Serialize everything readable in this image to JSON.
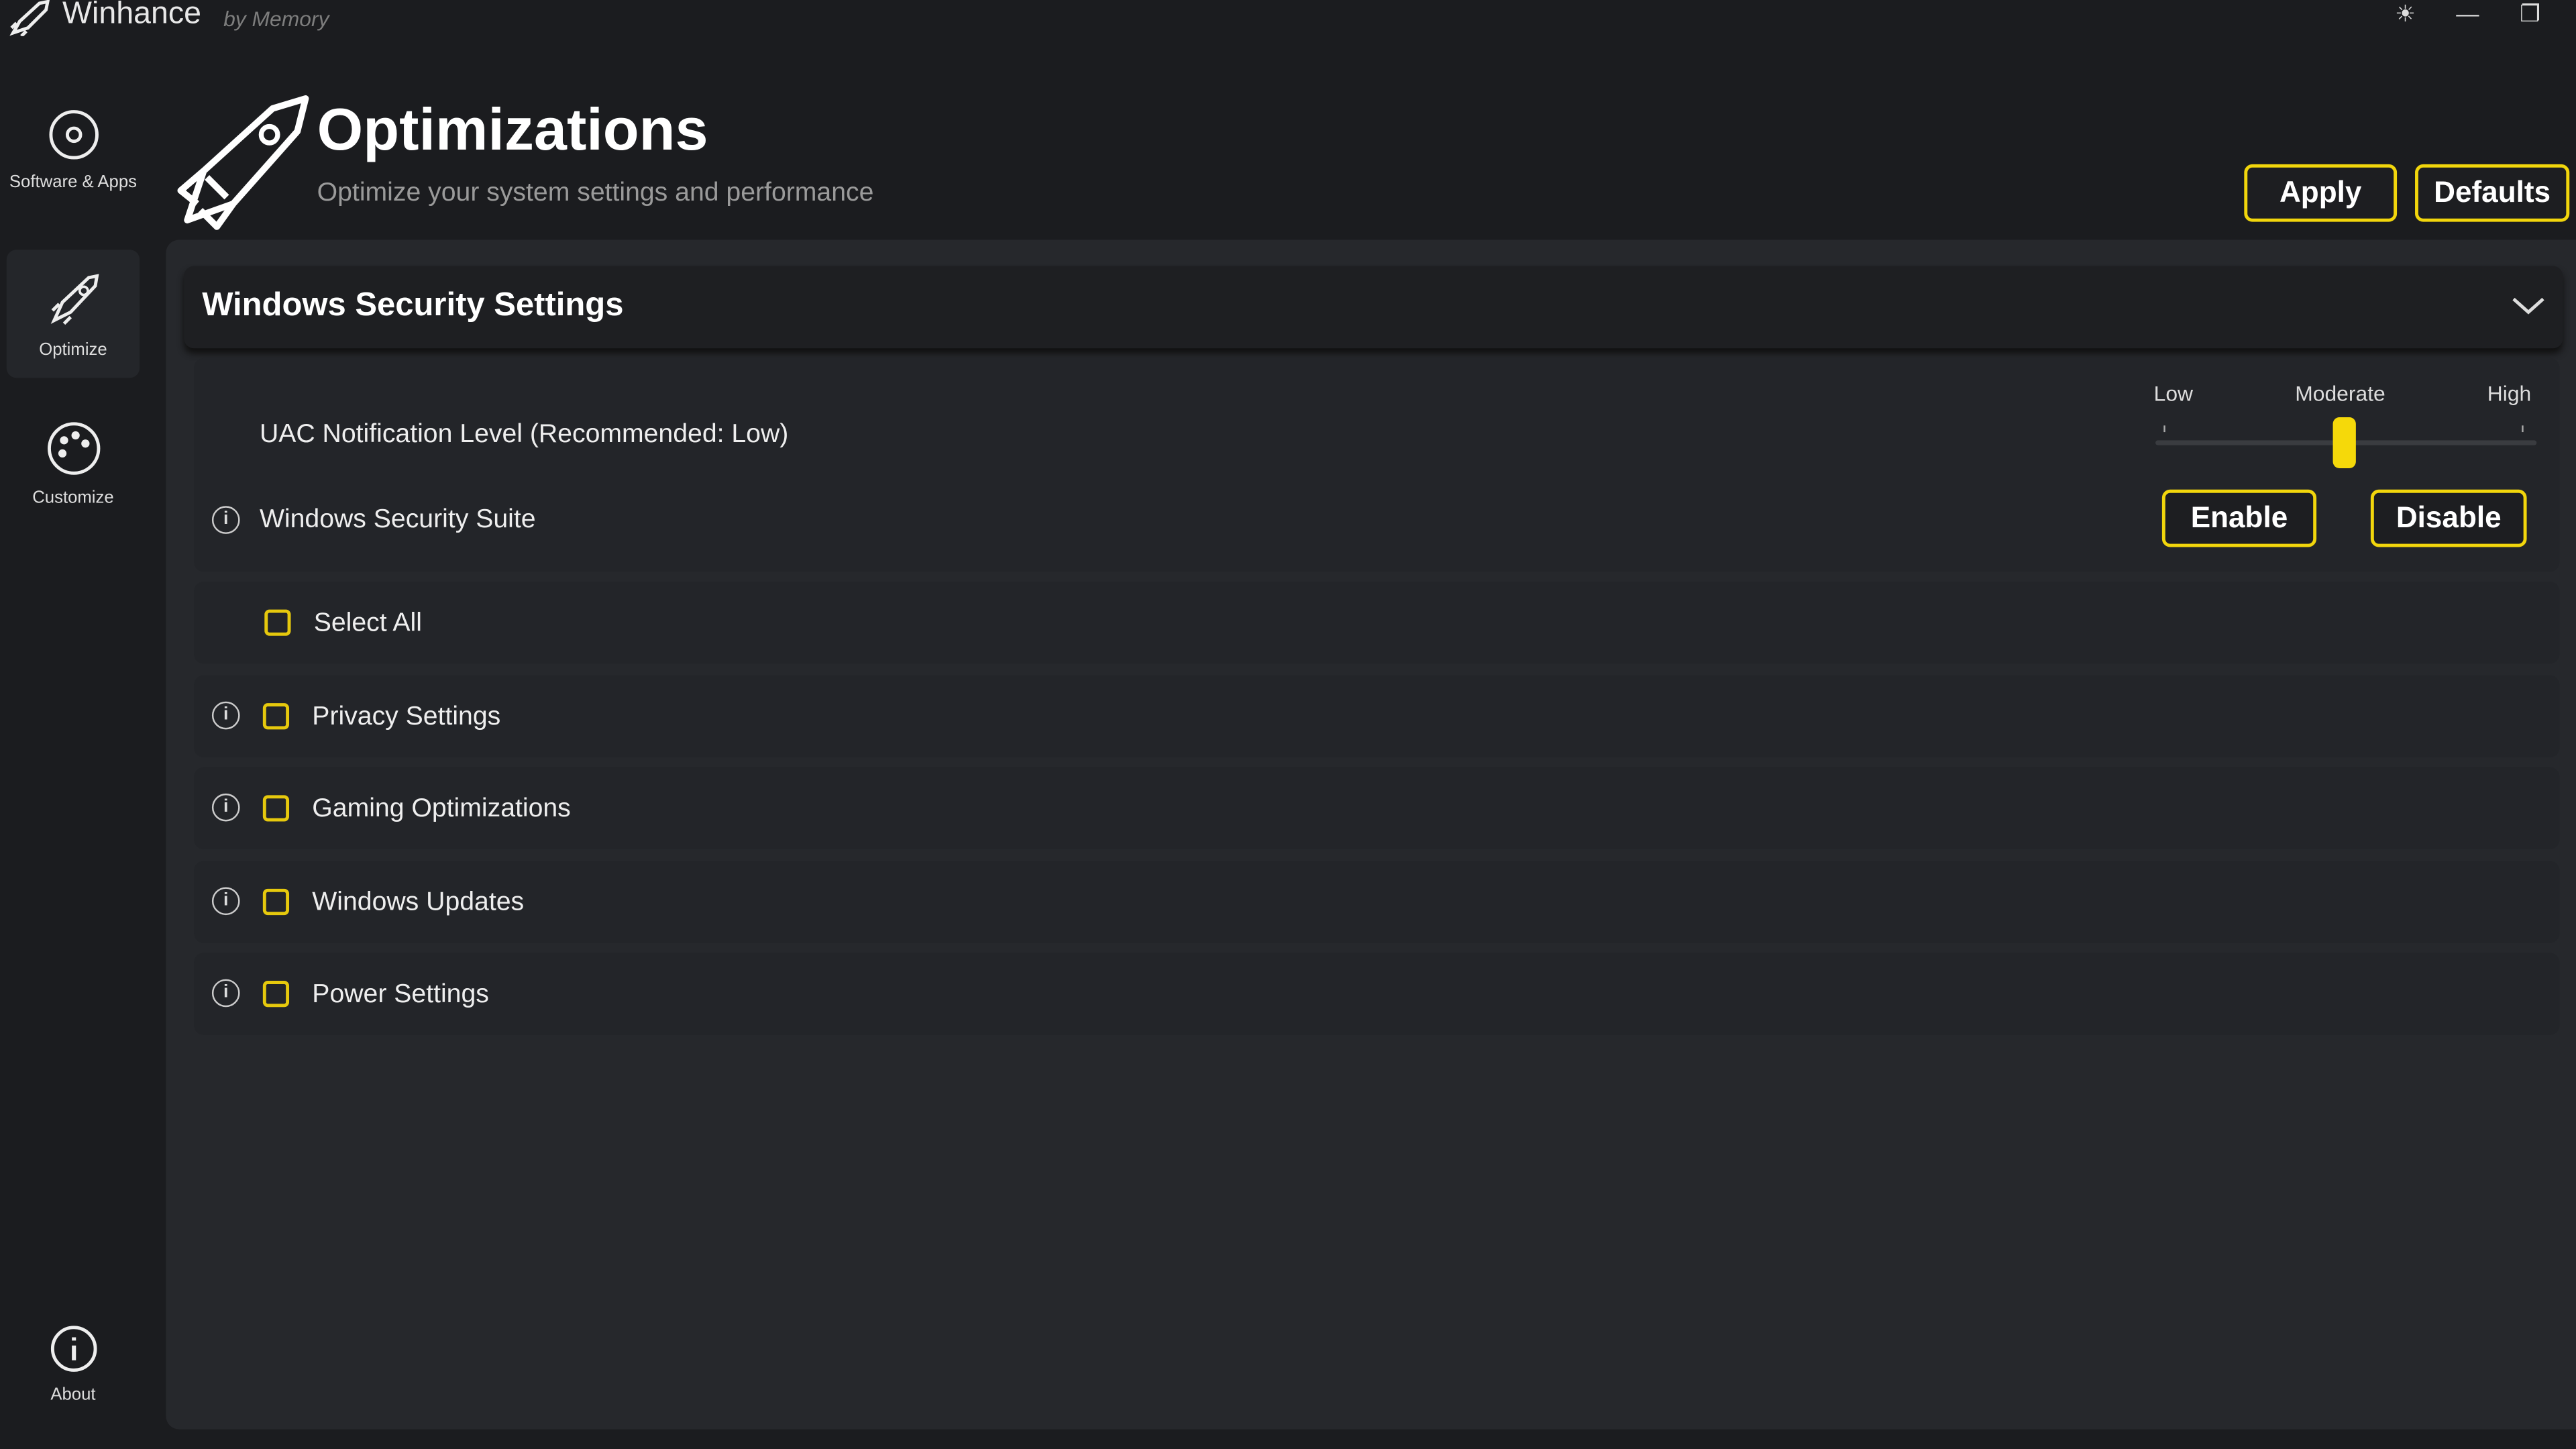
{
  "app": {
    "title": "Winhance",
    "subtitle": "by Memory",
    "icon": "rocket-icon"
  },
  "window_controls": {
    "theme": "sun-icon",
    "minimize": "minimize-icon",
    "restore": "restore-icon"
  },
  "sidebar": {
    "items": [
      {
        "label": "Software & Apps",
        "icon": "disc-icon",
        "active": false
      },
      {
        "label": "Optimize",
        "icon": "rocket-icon",
        "active": true
      },
      {
        "label": "Customize",
        "icon": "palette-icon",
        "active": false
      }
    ],
    "about": {
      "label": "About",
      "icon": "info-icon"
    }
  },
  "header": {
    "title": "Optimizations",
    "subtitle": "Optimize your system settings and performance",
    "apply": "Apply",
    "defaults": "Defaults"
  },
  "section": {
    "title": "Windows Security Settings",
    "expanded": true,
    "uac": {
      "label": "UAC Notification Level (Recommended: Low)",
      "levels": [
        "Low",
        "Moderate",
        "High"
      ],
      "selected": "Moderate",
      "value_fraction": 0.5
    },
    "suite": {
      "label": "Windows Security Suite",
      "enable": "Enable",
      "disable": "Disable"
    }
  },
  "select_all": {
    "label": "Select All",
    "checked": false
  },
  "categories": [
    {
      "label": "Privacy Settings",
      "checked": false
    },
    {
      "label": "Gaming Optimizations",
      "checked": false
    },
    {
      "label": "Windows Updates",
      "checked": false
    },
    {
      "label": "Power Settings",
      "checked": false
    }
  ],
  "colors": {
    "accent": "#f2d60c",
    "background": "#1b1c1f",
    "panel": "#26282c"
  }
}
